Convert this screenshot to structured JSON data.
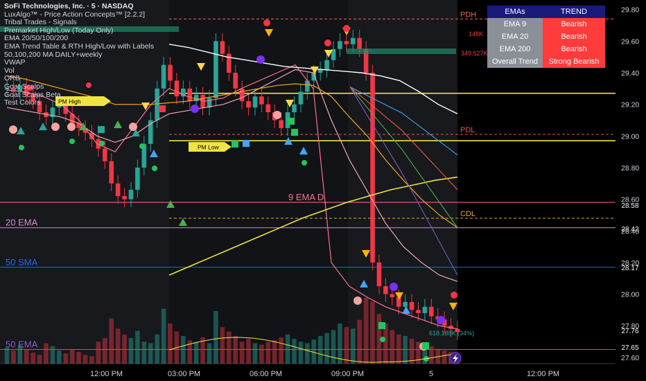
{
  "chart_data": {
    "type": "candlestick",
    "title": "SoFi Technologies, Inc. · 5 · NASDAQ",
    "ylim": [
      27.56,
      29.86
    ],
    "y_ticks": [
      "29.80",
      "29.60",
      "29.40",
      "29.20",
      "29.00",
      "28.80",
      "28.60",
      "28.40",
      "28.20",
      "28.00",
      "27.80",
      "27.60"
    ],
    "x_ticks": [
      "12:00 PM",
      "03:00 PM",
      "06:00 PM",
      "09:00 PM",
      "5",
      "12:00 PM"
    ],
    "price": [
      29.3,
      29.28,
      29.32,
      29.26,
      29.22,
      29.15,
      29.12,
      29.18,
      29.2,
      29.14,
      29.08,
      29.05,
      29.02,
      28.98,
      28.92,
      28.84,
      28.7,
      28.62,
      28.6,
      28.66,
      28.8,
      28.95,
      29.1,
      29.3,
      29.45,
      29.35,
      29.25,
      29.3,
      29.22,
      29.26,
      29.18,
      29.24,
      29.6,
      29.52,
      29.4,
      29.3,
      29.22,
      29.18,
      29.25,
      29.2,
      29.15,
      29.1,
      29.05,
      29.15,
      29.2,
      29.28,
      29.35,
      29.4,
      29.42,
      29.48,
      29.55,
      29.6,
      29.58,
      29.62,
      29.55,
      29.4,
      28.2,
      28.05,
      28.0,
      27.98,
      27.92,
      27.95,
      27.9,
      27.88,
      27.92,
      27.86,
      27.84,
      27.8,
      27.78,
      27.76
    ],
    "volume": [
      22,
      18,
      25,
      20,
      15,
      12,
      28,
      24,
      18,
      14,
      20,
      16,
      12,
      10,
      30,
      35,
      62,
      48,
      40,
      35,
      45,
      30,
      28,
      40,
      75,
      55,
      44,
      38,
      32,
      30,
      36,
      28,
      72,
      50,
      44,
      38,
      30,
      34,
      28,
      26,
      30,
      32,
      36,
      40,
      34,
      30,
      28,
      33,
      38,
      42,
      46,
      55,
      50,
      48,
      60,
      90,
      85,
      68,
      55,
      46,
      40,
      38,
      34,
      30,
      28,
      24,
      20,
      18,
      16,
      14
    ],
    "series": [
      {
        "name": "EMA 9",
        "values": [
          29.29,
          29.28,
          29.25,
          29.2,
          29.1,
          28.95,
          28.9,
          29.05,
          29.2,
          29.3,
          29.25,
          29.22,
          29.24,
          29.3,
          29.35,
          29.4,
          29.45,
          29.3,
          28.2,
          28.05,
          27.98,
          27.92,
          27.88,
          27.84,
          27.8,
          27.78
        ]
      },
      {
        "name": "EMA 20",
        "values": [
          29.18,
          29.16,
          29.14,
          29.12,
          29.08,
          29.0,
          28.96,
          29.0,
          29.08,
          29.14,
          29.16,
          29.18,
          29.2,
          29.24,
          29.3,
          29.36,
          29.42,
          29.4,
          29.1,
          28.85,
          28.65,
          28.45,
          28.3,
          28.2,
          28.12,
          28.08
        ]
      },
      {
        "name": "EMA 50",
        "values": [
          29.38,
          29.36,
          29.33,
          29.3,
          29.27,
          29.24,
          29.2,
          29.2,
          29.2,
          29.21,
          29.22,
          29.24,
          29.26,
          29.28,
          29.3,
          29.32,
          29.33,
          29.32,
          29.25,
          29.12,
          29.0,
          28.85,
          28.72,
          28.6,
          28.5,
          28.42
        ]
      },
      {
        "name": "EMA 200",
        "values": [
          28.12,
          28.18,
          28.24,
          28.3,
          28.36,
          28.42,
          28.48,
          28.53,
          28.58,
          28.62,
          28.66,
          28.69,
          28.72,
          28.74
        ]
      }
    ],
    "sma_200_white": [
      29.58,
      29.56,
      29.53,
      29.5,
      29.48,
      29.46,
      29.44,
      29.43,
      29.42,
      29.41,
      29.4,
      29.38,
      29.35,
      29.28,
      29.2,
      29.14
    ],
    "levels": [
      {
        "label": "PDH",
        "value": 29.74,
        "color": "#ef6c3b"
      },
      {
        "label": "PDL",
        "value": 29.01,
        "color": "#e0584f"
      },
      {
        "label": "CDL",
        "value": 28.48,
        "color": "#f5a623"
      },
      {
        "label": "9 EMA D",
        "value": 28.58,
        "color": "#ff6f91"
      },
      {
        "label": "20 EMA",
        "value": 28.42,
        "color": "#d08fd0"
      },
      {
        "label": "50 SMA",
        "value": 28.17,
        "color": "#2962ff"
      },
      {
        "label": "50 EMA",
        "value": 27.65,
        "color": "#8e5bd4"
      },
      {
        "label": "",
        "value": 29.27,
        "color": "#f0e442"
      },
      {
        "label": "",
        "value": 28.97,
        "color": "#f0e442"
      }
    ],
    "labels": {
      "pm_high": "PM High",
      "pm_low": "PM Low",
      "vol_hi": "349.527K",
      "vol_mid": "148K",
      "vol_bottom": "618.188K (34%)"
    }
  },
  "overlays": [
    "LuxAlgo™ - Price Action Concepts™ [2.2.2]",
    "Tribal Trades - Signals",
    "Premarket High/Low (Today Only)",
    "EMA 20/50/100/200",
    "EMA Trend Table & RTH High/Low with Labels",
    "50,100,200 MA DAILY+weekly",
    "VWAP",
    "Vol",
    "ORB",
    "Goat Scalps",
    "Goat Scalps Beta",
    "Test Colors"
  ],
  "ema_table": {
    "header": [
      "EMAs",
      "TREND"
    ],
    "rows": [
      {
        "label": "EMA 9",
        "trend": "Bearish"
      },
      {
        "label": "EMA 20",
        "trend": "Bearish"
      },
      {
        "label": "EMA 200",
        "trend": "Bearish"
      },
      {
        "label": "Overall Trend",
        "trend": "Strong Bearish"
      }
    ]
  },
  "price_tags": [
    {
      "value": "28.58",
      "bg": "#ff6f91",
      "fg": "#000000"
    },
    {
      "value": "28.42",
      "bg": "#d08fd0",
      "fg": "#000000"
    },
    {
      "value": "28.17",
      "bg": "#2962ff",
      "fg": "#ffffff"
    },
    {
      "value": "27.76",
      "bg": "#f23645",
      "fg": "#ffffff"
    },
    {
      "value": "27.65",
      "bg": "#8e5bd4",
      "fg": "#ffffff"
    }
  ],
  "colors": {
    "up": "#26a69a",
    "down": "#f23645",
    "bg": "#000000"
  }
}
